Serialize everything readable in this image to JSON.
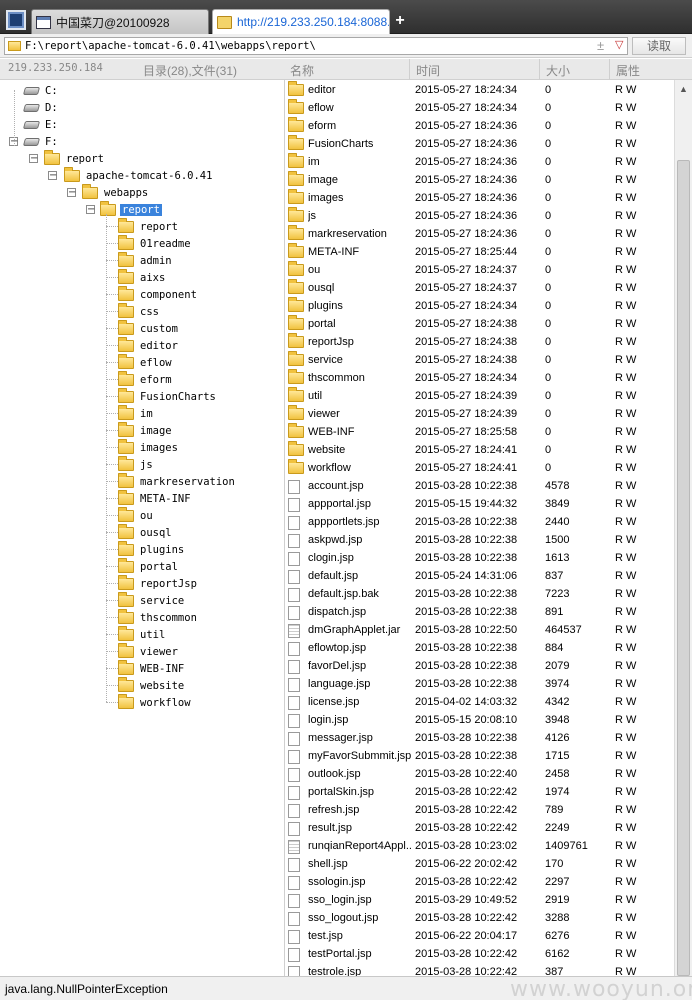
{
  "tabs": [
    {
      "label": "中国菜刀@20100928"
    },
    {
      "label": "http://219.233.250.184:8088..."
    }
  ],
  "newtab_label": "+",
  "address": {
    "value": "F:\\report\\apache-tomcat-6.0.41\\webapps\\report\\",
    "read_label": "读取",
    "add_label": "±",
    "dropdown_label": "▽"
  },
  "header": {
    "host_ip": "219.233.250.184",
    "counts": "目录(28),文件(31)",
    "col_name": "名称",
    "col_time": "时间",
    "col_size": "大小",
    "col_attr": "属性"
  },
  "tree": {
    "drives": [
      "C:",
      "D:",
      "E:",
      "F:"
    ],
    "path_nodes": [
      "report",
      "apache-tomcat-6.0.41",
      "webapps",
      "report"
    ],
    "children": [
      "report",
      "01readme",
      "admin",
      "aixs",
      "component",
      "css",
      "custom",
      "editor",
      "eflow",
      "eform",
      "FusionCharts",
      "im",
      "image",
      "images",
      "js",
      "markreservation",
      "META-INF",
      "ou",
      "ousql",
      "plugins",
      "portal",
      "reportJsp",
      "service",
      "thscommon",
      "util",
      "viewer",
      "WEB-INF",
      "website",
      "workflow"
    ]
  },
  "files": [
    {
      "name": "editor",
      "time": "2015-05-27 18:24:34",
      "size": "0",
      "attr": "R W",
      "type": "folder"
    },
    {
      "name": "eflow",
      "time": "2015-05-27 18:24:34",
      "size": "0",
      "attr": "R W",
      "type": "folder"
    },
    {
      "name": "eform",
      "time": "2015-05-27 18:24:36",
      "size": "0",
      "attr": "R W",
      "type": "folder"
    },
    {
      "name": "FusionCharts",
      "time": "2015-05-27 18:24:36",
      "size": "0",
      "attr": "R W",
      "type": "folder"
    },
    {
      "name": "im",
      "time": "2015-05-27 18:24:36",
      "size": "0",
      "attr": "R W",
      "type": "folder"
    },
    {
      "name": "image",
      "time": "2015-05-27 18:24:36",
      "size": "0",
      "attr": "R W",
      "type": "folder"
    },
    {
      "name": "images",
      "time": "2015-05-27 18:24:36",
      "size": "0",
      "attr": "R W",
      "type": "folder"
    },
    {
      "name": "js",
      "time": "2015-05-27 18:24:36",
      "size": "0",
      "attr": "R W",
      "type": "folder"
    },
    {
      "name": "markreservation",
      "time": "2015-05-27 18:24:36",
      "size": "0",
      "attr": "R W",
      "type": "folder"
    },
    {
      "name": "META-INF",
      "time": "2015-05-27 18:25:44",
      "size": "0",
      "attr": "R W",
      "type": "folder"
    },
    {
      "name": "ou",
      "time": "2015-05-27 18:24:37",
      "size": "0",
      "attr": "R W",
      "type": "folder"
    },
    {
      "name": "ousql",
      "time": "2015-05-27 18:24:37",
      "size": "0",
      "attr": "R W",
      "type": "folder"
    },
    {
      "name": "plugins",
      "time": "2015-05-27 18:24:34",
      "size": "0",
      "attr": "R W",
      "type": "folder"
    },
    {
      "name": "portal",
      "time": "2015-05-27 18:24:38",
      "size": "0",
      "attr": "R W",
      "type": "folder"
    },
    {
      "name": "reportJsp",
      "time": "2015-05-27 18:24:38",
      "size": "0",
      "attr": "R W",
      "type": "folder"
    },
    {
      "name": "service",
      "time": "2015-05-27 18:24:38",
      "size": "0",
      "attr": "R W",
      "type": "folder"
    },
    {
      "name": "thscommon",
      "time": "2015-05-27 18:24:34",
      "size": "0",
      "attr": "R W",
      "type": "folder"
    },
    {
      "name": "util",
      "time": "2015-05-27 18:24:39",
      "size": "0",
      "attr": "R W",
      "type": "folder"
    },
    {
      "name": "viewer",
      "time": "2015-05-27 18:24:39",
      "size": "0",
      "attr": "R W",
      "type": "folder"
    },
    {
      "name": "WEB-INF",
      "time": "2015-05-27 18:25:58",
      "size": "0",
      "attr": "R W",
      "type": "folder"
    },
    {
      "name": "website",
      "time": "2015-05-27 18:24:41",
      "size": "0",
      "attr": "R W",
      "type": "folder"
    },
    {
      "name": "workflow",
      "time": "2015-05-27 18:24:41",
      "size": "0",
      "attr": "R W",
      "type": "folder"
    },
    {
      "name": "account.jsp",
      "time": "2015-03-28 10:22:38",
      "size": "4578",
      "attr": "R W",
      "type": "file"
    },
    {
      "name": "appportal.jsp",
      "time": "2015-05-15 19:44:32",
      "size": "3849",
      "attr": "R W",
      "type": "file"
    },
    {
      "name": "appportlets.jsp",
      "time": "2015-03-28 10:22:38",
      "size": "2440",
      "attr": "R W",
      "type": "file"
    },
    {
      "name": "askpwd.jsp",
      "time": "2015-03-28 10:22:38",
      "size": "1500",
      "attr": "R W",
      "type": "file"
    },
    {
      "name": "clogin.jsp",
      "time": "2015-03-28 10:22:38",
      "size": "1613",
      "attr": "R W",
      "type": "file"
    },
    {
      "name": "default.jsp",
      "time": "2015-05-24 14:31:06",
      "size": "837",
      "attr": "R W",
      "type": "file"
    },
    {
      "name": "default.jsp.bak",
      "time": "2015-03-28 10:22:38",
      "size": "7223",
      "attr": "R W",
      "type": "file"
    },
    {
      "name": "dispatch.jsp",
      "time": "2015-03-28 10:22:38",
      "size": "891",
      "attr": "R W",
      "type": "file"
    },
    {
      "name": "dmGraphApplet.jar",
      "time": "2015-03-28 10:22:50",
      "size": "464537",
      "attr": "R W",
      "type": "jar"
    },
    {
      "name": "eflowtop.jsp",
      "time": "2015-03-28 10:22:38",
      "size": "884",
      "attr": "R W",
      "type": "file"
    },
    {
      "name": "favorDel.jsp",
      "time": "2015-03-28 10:22:38",
      "size": "2079",
      "attr": "R W",
      "type": "file"
    },
    {
      "name": "language.jsp",
      "time": "2015-03-28 10:22:38",
      "size": "3974",
      "attr": "R W",
      "type": "file"
    },
    {
      "name": "license.jsp",
      "time": "2015-04-02 14:03:32",
      "size": "4342",
      "attr": "R W",
      "type": "file"
    },
    {
      "name": "login.jsp",
      "time": "2015-05-15 20:08:10",
      "size": "3948",
      "attr": "R W",
      "type": "file"
    },
    {
      "name": "messager.jsp",
      "time": "2015-03-28 10:22:38",
      "size": "4126",
      "attr": "R W",
      "type": "file"
    },
    {
      "name": "myFavorSubmmit.jsp",
      "time": "2015-03-28 10:22:38",
      "size": "1715",
      "attr": "R W",
      "type": "file"
    },
    {
      "name": "outlook.jsp",
      "time": "2015-03-28 10:22:40",
      "size": "2458",
      "attr": "R W",
      "type": "file"
    },
    {
      "name": "portalSkin.jsp",
      "time": "2015-03-28 10:22:42",
      "size": "1974",
      "attr": "R W",
      "type": "file"
    },
    {
      "name": "refresh.jsp",
      "time": "2015-03-28 10:22:42",
      "size": "789",
      "attr": "R W",
      "type": "file"
    },
    {
      "name": "result.jsp",
      "time": "2015-03-28 10:22:42",
      "size": "2249",
      "attr": "R W",
      "type": "file"
    },
    {
      "name": "runqianReport4Appl...",
      "time": "2015-03-28 10:23:02",
      "size": "1409761",
      "attr": "R W",
      "type": "jar"
    },
    {
      "name": "shell.jsp",
      "time": "2015-06-22 20:02:42",
      "size": "170",
      "attr": "R W",
      "type": "file"
    },
    {
      "name": "ssologin.jsp",
      "time": "2015-03-28 10:22:42",
      "size": "2297",
      "attr": "R W",
      "type": "file"
    },
    {
      "name": "sso_login.jsp",
      "time": "2015-03-29 10:49:52",
      "size": "2919",
      "attr": "R W",
      "type": "file"
    },
    {
      "name": "sso_logout.jsp",
      "time": "2015-03-28 10:22:42",
      "size": "3288",
      "attr": "R W",
      "type": "file"
    },
    {
      "name": "test.jsp",
      "time": "2015-06-22 20:04:17",
      "size": "6276",
      "attr": "R W",
      "type": "file"
    },
    {
      "name": "testPortal.jsp",
      "time": "2015-03-28 10:22:42",
      "size": "6162",
      "attr": "R W",
      "type": "file"
    },
    {
      "name": "testrole.jsp",
      "time": "2015-03-28 10:22:42",
      "size": "387",
      "attr": "R W",
      "type": "file"
    }
  ],
  "status": {
    "message": "java.lang.NullPointerException",
    "watermark": "www.wooyun.org"
  }
}
